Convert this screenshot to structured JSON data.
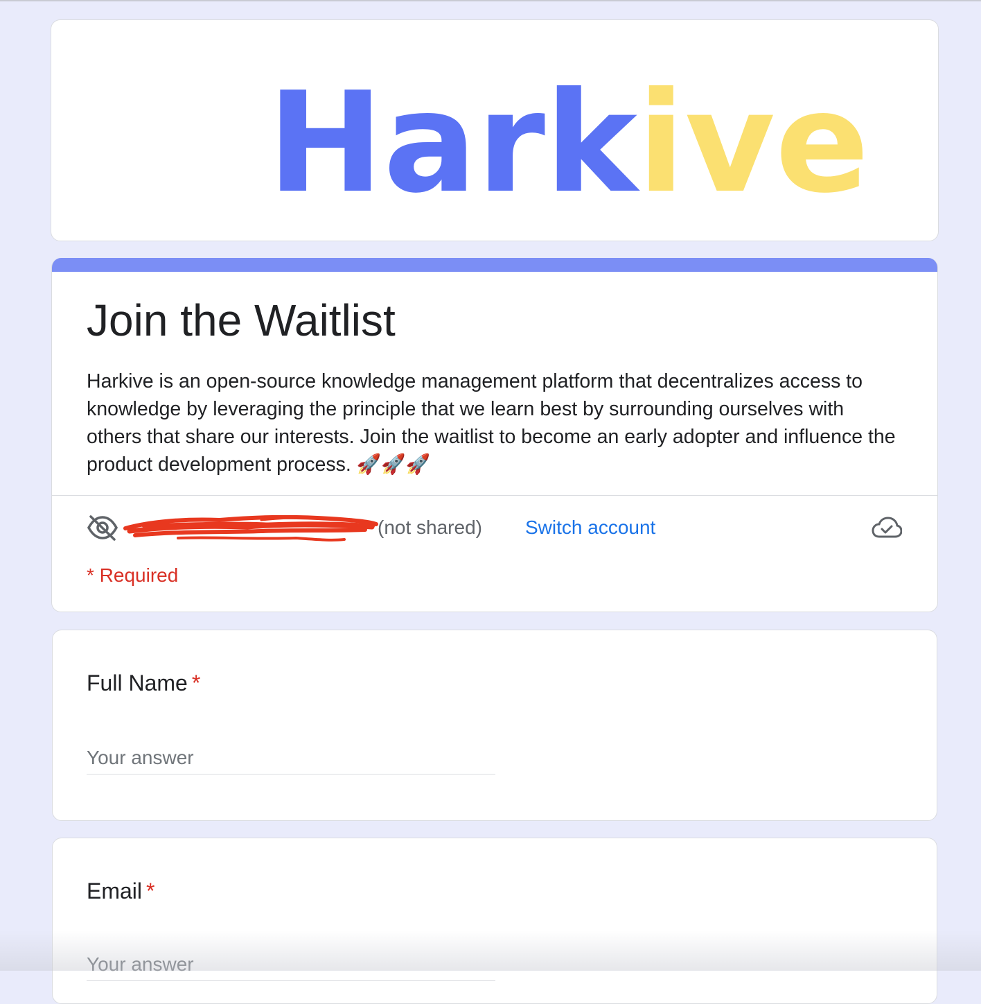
{
  "logo": {
    "part1": "Hark",
    "part2": "ive"
  },
  "form": {
    "title": "Join the Waitlist",
    "description": "Harkive is an open-source knowledge management platform that decentralizes access to knowledge by leveraging the principle that we learn best by surrounding ourselves with others that share our interests. Join the waitlist to become an early adopter and influence the product development process. 🚀🚀🚀",
    "account": {
      "not_shared": "(not shared)",
      "switch_account": "Switch account"
    },
    "required_note": "* Required"
  },
  "questions": [
    {
      "label": "Full Name",
      "required_mark": "*",
      "placeholder": "Your answer"
    },
    {
      "label": "Email",
      "required_mark": "*",
      "placeholder": "Your answer"
    }
  ],
  "colors": {
    "page_background": "#e9ebfb",
    "logo_blue": "#5b73f4",
    "logo_yellow": "#fbe071",
    "accent_bar": "#7b8ef5",
    "link": "#1a73e8",
    "required": "#d93025",
    "redaction": "#e8381f"
  },
  "icons": {
    "visibility": "eye-off-icon",
    "cloud": "cloud-done-icon"
  }
}
